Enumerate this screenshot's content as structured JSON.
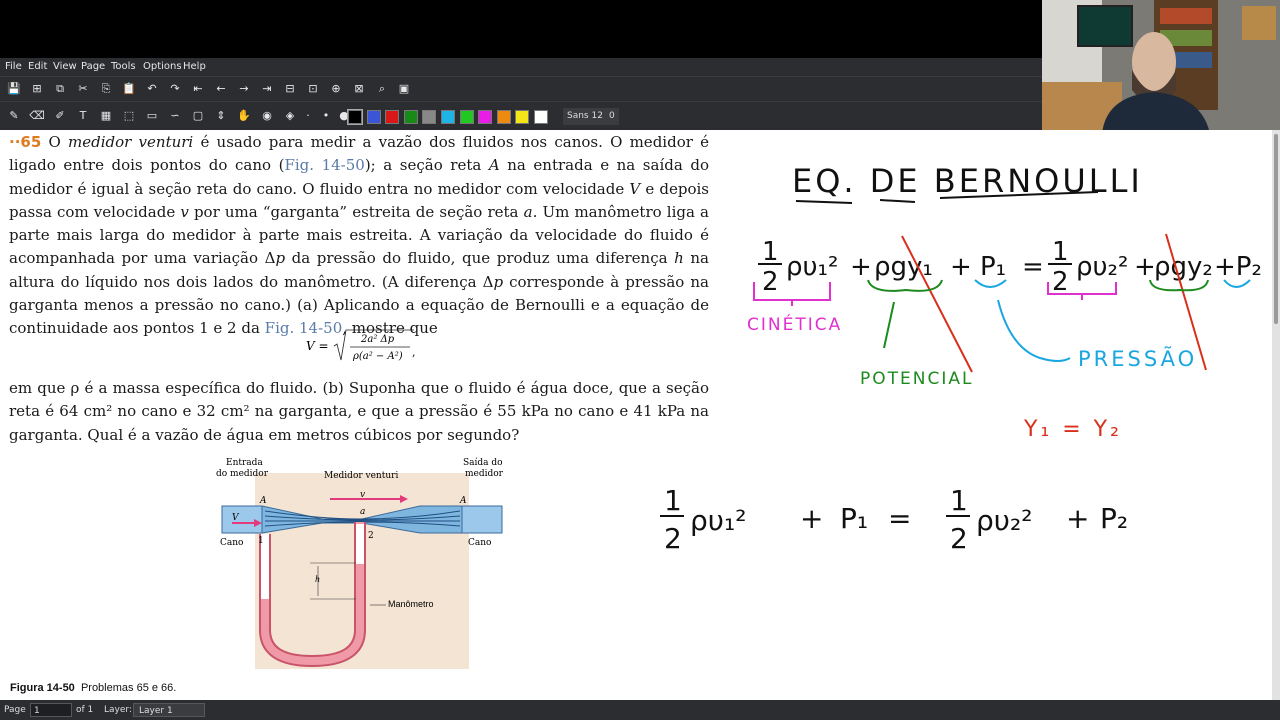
{
  "menu": [
    "File",
    "Edit",
    "View",
    "Page",
    "Tools",
    "Options",
    "Help"
  ],
  "toolbar": {
    "icons": [
      "save-icon",
      "new-page-icon",
      "duplicate-page-icon",
      "cut-icon",
      "copy-icon",
      "paste-icon",
      "undo-icon",
      "redo-icon",
      "first-page-icon",
      "prev-page-icon",
      "next-page-icon",
      "last-page-icon",
      "delete-page-icon",
      "insert-page-icon",
      "zoom-in-icon",
      "zoom-fit-icon",
      "search-icon",
      "fullscreen-icon"
    ],
    "tools": [
      "pen-icon",
      "eraser-icon",
      "highlighter-icon",
      "text-icon",
      "image-icon",
      "select-region-icon",
      "ruler-icon",
      "lasso-icon",
      "rect-select-icon",
      "vertical-space-icon",
      "hand-icon",
      "shape-recognizer-icon",
      "default-tool-icon",
      "thin-dot-icon",
      "medium-dot-icon",
      "thick-dot-icon"
    ],
    "colors": [
      "#000000",
      "#3a55d8",
      "#d81818",
      "#178a17",
      "#888888",
      "#1fb4e6",
      "#21c821",
      "#e81ee8",
      "#ee8a12",
      "#f2e616",
      "#ffffff"
    ],
    "font_label": "Sans 12",
    "font_size": "0"
  },
  "problem": {
    "number": "65",
    "prefix": "··",
    "text_parts": [
      " O ",
      "medidor venturi",
      " é usado para medir a vazão dos fluidos nos canos. O medidor é ligado entre dois pontos do cano (",
      "Fig. 14-50",
      "); a seção reta ",
      "A",
      " na entrada e na saída do medidor é igual à seção reta do cano. O fluido entra no medidor com velocidade ",
      "V",
      " e depois passa com velocidade ",
      "v",
      " por uma “garganta” estreita de seção reta ",
      "a",
      ". Um manômetro liga a parte mais larga do medidor à parte mais estreita. A variação da velocidade do fluido é acompanhada por uma variação Δ",
      "p",
      " da pressão do fluido, que produz uma diferença ",
      "h",
      " na altura do líquido nos dois lados do manômetro. (A diferença Δ",
      "p",
      " corresponde à pressão na garganta menos a pressão no cano.) (a) Aplicando a equação de Bernoulli e a equação de continuidade aos pontos 1 e 2 da ",
      "Fig. 14-50",
      ", mostre que"
    ],
    "formula_lhs": "V =",
    "formula_num": "2a² Δp",
    "formula_den": "ρ(a² − A²)",
    "text2": "em que ρ é a massa específica do fluido. (b) Suponha que o fluido é água doce, que a seção reta é 64 cm² no cano e 32 cm² na garganta, e que a pressão é 55 kPa no cano e 41 kPa na garganta. Qual é a vazão de água em metros cúbicos por segundo?"
  },
  "figure": {
    "entrada": [
      "Entrada",
      "do medidor"
    ],
    "saida": [
      "Saída do",
      "medidor"
    ],
    "medidor": "Medidor venturi",
    "cano_left": "Cano",
    "cano_right": "Cano",
    "manometro": "Manômetro",
    "label_A1": "A",
    "label_A2": "A",
    "label_a": "a",
    "label_V": "V",
    "label_v": "v",
    "label_1": "1",
    "label_2": "2",
    "label_h": "h"
  },
  "caption": {
    "label": "Figura 14-50",
    "text": "Problemas 65 e 66."
  },
  "handwriting": {
    "title": "EQ. DE BERNOULLI",
    "cinetica": "CINÉTICA",
    "potencial": "POTENCIAL",
    "pressao": "PRESSÃO",
    "y_eq": "Y₁ = Y₂"
  },
  "status": {
    "page_label": "Page",
    "page_value": "1",
    "of_label": "of 1",
    "layer_label": "Layer:",
    "layer_value": "Layer 1"
  }
}
